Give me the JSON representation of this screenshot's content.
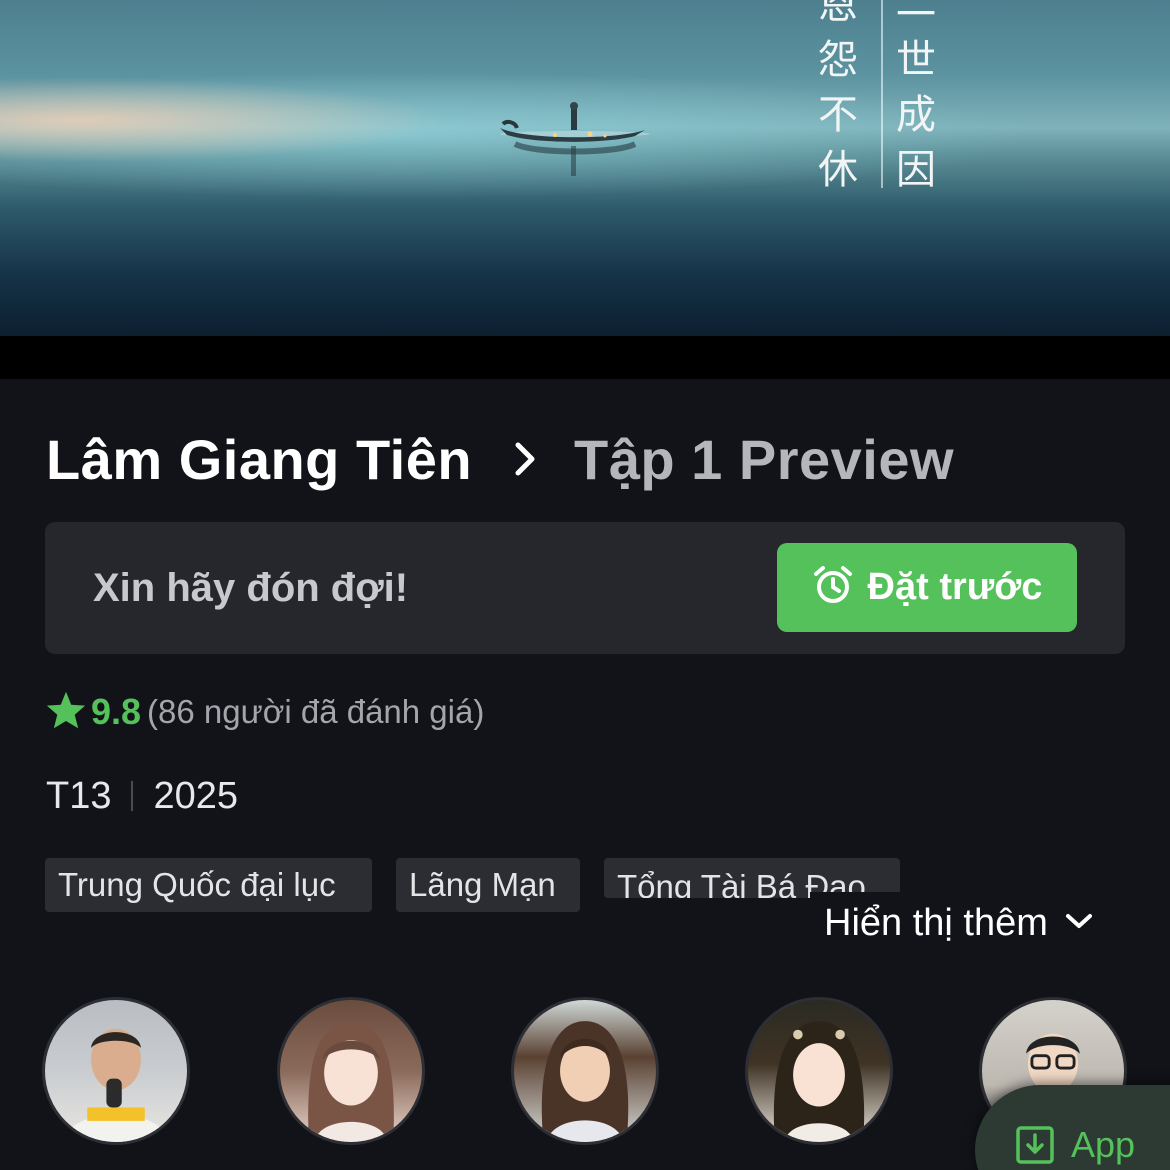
{
  "banner": {
    "image_label": "drama-banner",
    "calligraphy": [
      "一",
      "世",
      "成",
      "因",
      "恩",
      "怨",
      "不",
      "休"
    ]
  },
  "title": {
    "show": "Lâm Giang Tiên",
    "episode": "Tập 1 Preview"
  },
  "reserve": {
    "message": "Xin hãy đón đợi!",
    "button_label": "Đặt trước"
  },
  "rating": {
    "score": "9.8",
    "count_text": "(86 người đã đánh giá)"
  },
  "meta": {
    "age_rating": "T13",
    "year": "2025"
  },
  "tags": [
    "Trung Quốc đại lục",
    "Lãng Mạn",
    "Tổng Tài Bá Đạo"
  ],
  "show_more": "Hiển thị thêm",
  "app_button": "App",
  "colors": {
    "accent_green": "#54c15a",
    "background": "#111319",
    "panel": "#25272d",
    "tag_bg": "#2b2d33"
  },
  "icons": {
    "chevron": "chevron-right-icon",
    "alarm": "alarm-clock-icon",
    "star": "star-icon",
    "expand": "chevron-down-icon",
    "download": "download-icon"
  }
}
